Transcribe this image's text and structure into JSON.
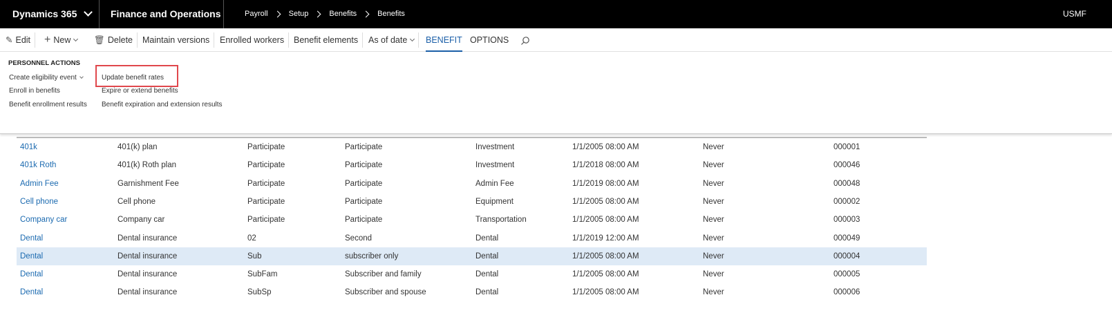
{
  "topbar": {
    "app_name": "Dynamics 365",
    "module": "Finance and Operations",
    "breadcrumbs": [
      "Payroll",
      "Setup",
      "Benefits",
      "Benefits"
    ],
    "company": "USMF"
  },
  "actionbar": {
    "edit": "Edit",
    "new": "New",
    "delete": "Delete",
    "maintain_versions": "Maintain versions",
    "enrolled_workers": "Enrolled workers",
    "benefit_elements": "Benefit elements",
    "as_of_date": "As of date",
    "tab_benefit": "BENEFIT",
    "tab_options": "OPTIONS"
  },
  "panel": {
    "group_title": "PERSONNEL ACTIONS",
    "create_eligibility_event": "Create eligibility event",
    "enroll_in_benefits": "Enroll in benefits",
    "benefit_enrollment_results": "Benefit enrollment results",
    "update_benefit_rates": "Update benefit rates",
    "expire_or_extend_benefits": "Expire or extend benefits",
    "benefit_expiration_results": "Benefit expiration and extension results"
  },
  "grid": {
    "rows": [
      {
        "plan": "401k",
        "description": "401(k) plan",
        "option": "Participate",
        "option_desc": "Participate",
        "type": "Investment",
        "valid_from": "1/1/2005 08:00 AM",
        "valid_to": "Never",
        "id": "000001"
      },
      {
        "plan": "401k Roth",
        "description": "401(k) Roth plan",
        "option": "Participate",
        "option_desc": "Participate",
        "type": "Investment",
        "valid_from": "1/1/2018 08:00 AM",
        "valid_to": "Never",
        "id": "000046"
      },
      {
        "plan": "Admin Fee",
        "description": "Garnishment Fee",
        "option": "Participate",
        "option_desc": "Participate",
        "type": "Admin Fee",
        "valid_from": "1/1/2019 08:00 AM",
        "valid_to": "Never",
        "id": "000048"
      },
      {
        "plan": "Cell phone",
        "description": "Cell phone",
        "option": "Participate",
        "option_desc": "Participate",
        "type": "Equipment",
        "valid_from": "1/1/2005 08:00 AM",
        "valid_to": "Never",
        "id": "000002"
      },
      {
        "plan": "Company car",
        "description": "Company car",
        "option": "Participate",
        "option_desc": "Participate",
        "type": "Transportation",
        "valid_from": "1/1/2005 08:00 AM",
        "valid_to": "Never",
        "id": "000003"
      },
      {
        "plan": "Dental",
        "description": "Dental insurance",
        "option": "02",
        "option_desc": "Second",
        "type": "Dental",
        "valid_from": "1/1/2019 12:00 AM",
        "valid_to": "Never",
        "id": "000049"
      },
      {
        "plan": "Dental",
        "description": "Dental insurance",
        "option": "Sub",
        "option_desc": "subscriber only",
        "type": "Dental",
        "valid_from": "1/1/2005 08:00 AM",
        "valid_to": "Never",
        "id": "000004"
      },
      {
        "plan": "Dental",
        "description": "Dental insurance",
        "option": "SubFam",
        "option_desc": "Subscriber and family",
        "type": "Dental",
        "valid_from": "1/1/2005 08:00 AM",
        "valid_to": "Never",
        "id": "000005"
      },
      {
        "plan": "Dental",
        "description": "Dental insurance",
        "option": "SubSp",
        "option_desc": "Subscriber and spouse",
        "type": "Dental",
        "valid_from": "1/1/2005 08:00 AM",
        "valid_to": "Never",
        "id": "000006"
      }
    ]
  },
  "colors": {
    "accent": "#1b5fa8",
    "link": "#1b6ab0",
    "selected_row": "#deeaf6",
    "highlight_border": "#e0474c"
  }
}
